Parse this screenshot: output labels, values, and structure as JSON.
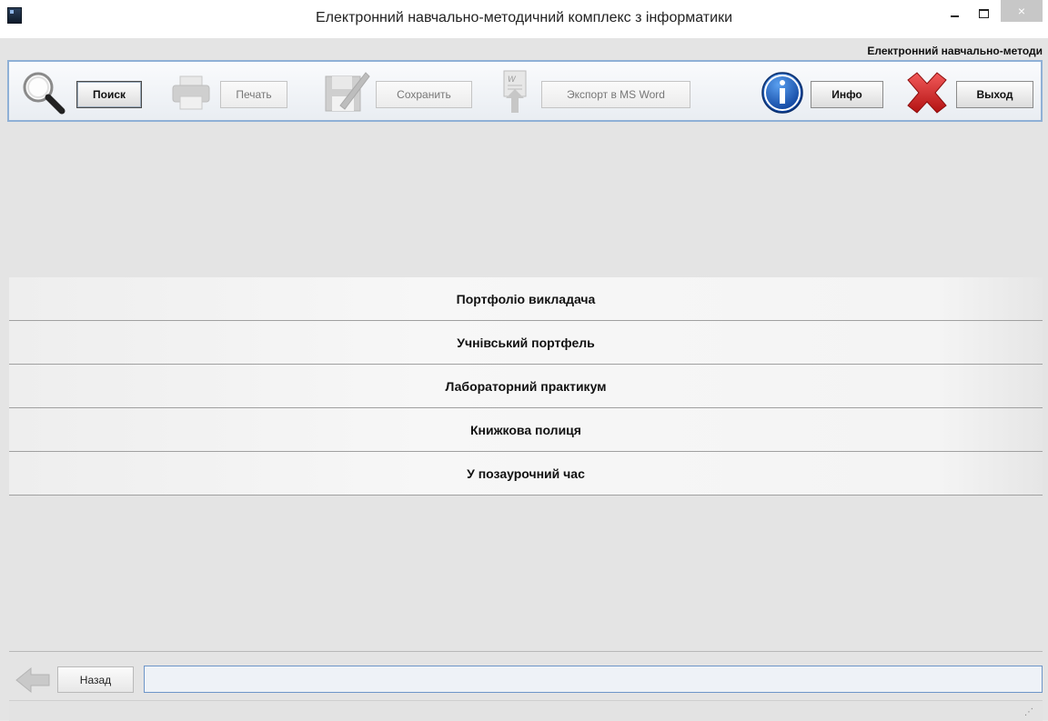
{
  "window": {
    "title": "Електронний навчально-методичний комплекс з інформатики",
    "subtitle": "Електронний навчально-методи",
    "controls": {
      "minimize": "–",
      "maximize": "□",
      "close": "×"
    }
  },
  "toolbar": {
    "search_label": "Поиск",
    "print_label": "Печать",
    "save_label": "Сохранить",
    "export_label": "Экспорт в MS Word",
    "info_label": "Инфо",
    "exit_label": "Выход"
  },
  "menu": {
    "items": [
      {
        "label": "Портфоліо викладача"
      },
      {
        "label": "Учнівський портфель"
      },
      {
        "label": "Лабораторний практикум"
      },
      {
        "label": "Книжкова полиця"
      },
      {
        "label": "У позаурочний час"
      }
    ]
  },
  "bottom": {
    "back_label": "Назад",
    "path_value": ""
  },
  "colors": {
    "accent": "#8fb0d6",
    "info_blue": "#1565c0",
    "exit_red": "#d32f2f"
  }
}
